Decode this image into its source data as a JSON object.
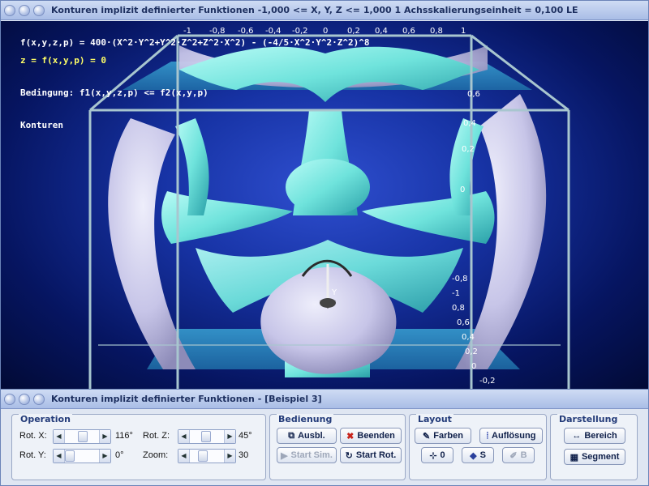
{
  "main_window": {
    "title": "Konturen implizit definierter Funktionen    -1,000 <= X, Y, Z <= 1,000    1 Achsskalierungseinheit = 0,100 LE"
  },
  "overlay": {
    "line1": "f(x,y,z,p) = 400·(X^2·Y^2+Y^2·Z^2+Z^2·X^2) - (-4/5·X^2·Y^2·Z^2)^8",
    "line2": "z = f(x,y,p) = 0",
    "line3": "Bedingung: f1(x,y,z,p) <= f2(x,y,p)",
    "line4": "Konturen"
  },
  "axis": {
    "top_ticks": [
      "-1",
      "-0,8",
      "-0,6",
      "-0,4",
      "-0,2",
      "0",
      "0,2",
      "0,4",
      "0,6",
      "0,8",
      "1"
    ],
    "right_ticks_upper": [
      "0,6",
      "0,4",
      "0,2",
      "0"
    ],
    "right_ticks_lower": [
      "-0,8",
      "-1",
      "0,8",
      "0,6",
      "0,4",
      "0,2",
      "0",
      "-0,2"
    ],
    "y_label": "Y"
  },
  "panel_window": {
    "title": "Konturen implizit definierter Funktionen - [Beispiel 3]"
  },
  "operation": {
    "title": "Operation",
    "rot_x_label": "Rot. X:",
    "rot_x_value": "116°",
    "rot_y_label": "Rot. Y:",
    "rot_y_value": "0°",
    "rot_z_label": "Rot. Z:",
    "rot_z_value": "45°",
    "zoom_label": "Zoom:",
    "zoom_value": "30"
  },
  "bedienung": {
    "title": "Bedienung",
    "ausbl": "Ausbl.",
    "beenden": "Beenden",
    "start_sim": "Start Sim.",
    "start_rot": "Start Rot."
  },
  "layout": {
    "title": "Layout",
    "farben": "Farben",
    "aufloesung": "Auflösung",
    "btn_0": "0",
    "btn_s": "S",
    "btn_b": "B"
  },
  "darstellung": {
    "title": "Darstellung",
    "bereich": "Bereich",
    "segment": "Segment"
  },
  "colors": {
    "cyan_surface": "#6fe3dc",
    "lavender_surface": "#c7c5e8",
    "background": "#0a1c7a",
    "formula_text": "#ffffff",
    "z_text": "#ffff66"
  }
}
